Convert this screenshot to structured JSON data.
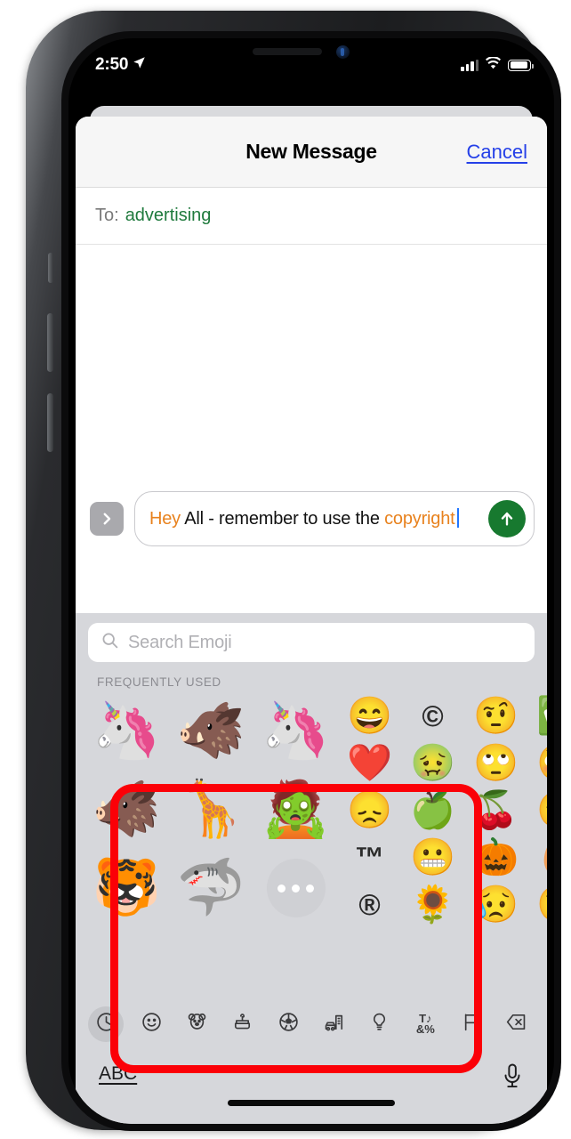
{
  "status_bar": {
    "time": "2:50",
    "location_icon": "location-arrow-icon",
    "signal_icon": "cellular-signal-icon",
    "wifi_icon": "wifi-icon",
    "battery_icon": "battery-icon"
  },
  "sheet": {
    "title": "New Message",
    "cancel_label": "Cancel"
  },
  "to_field": {
    "label": "To:",
    "value": "advertising",
    "value_color": "#1f7a3d"
  },
  "compose": {
    "expand_icon": "chevron-right-icon",
    "message_parts": [
      {
        "text": "Hey",
        "highlight": true
      },
      {
        "text": " All - remember to use the ",
        "highlight": false
      },
      {
        "text": "copyright",
        "highlight": true
      }
    ],
    "message_plain": "Hey All - remember to use the copyright",
    "highlight_color": "#e8821e",
    "send_icon": "send-arrow-up-icon",
    "send_color": "#17792f"
  },
  "emoji_keyboard": {
    "search": {
      "icon": "search-icon",
      "placeholder": "Search Emoji",
      "value": ""
    },
    "section_label": "FREQUENTLY USED",
    "memoji_columns": [
      {
        "name": "memoji-column-1",
        "items": [
          {
            "glyph": "🦄",
            "name": "memoji-unicorn-heart"
          },
          {
            "glyph": "🐗",
            "name": "memoji-boar-sleeping"
          },
          {
            "glyph": "🐯",
            "name": "memoji-tiger-heart-eyes"
          }
        ]
      },
      {
        "name": "memoji-column-2",
        "items": [
          {
            "glyph": "🐗",
            "name": "memoji-boar-laughing-tears"
          },
          {
            "glyph": "🦒",
            "name": "memoji-giraffe-heart"
          },
          {
            "glyph": "🦈",
            "name": "memoji-shark-heart-eyes"
          }
        ]
      },
      {
        "name": "memoji-column-3",
        "items": [
          {
            "glyph": "🦄",
            "name": "memoji-unicorn-mind-blown"
          },
          {
            "glyph": "🧟",
            "name": "memoji-zombie-star-eyes"
          },
          {
            "glyph": "",
            "name": "memoji-more-button"
          }
        ]
      }
    ],
    "emoji_columns": [
      {
        "name": "emoji-column-4",
        "items": [
          {
            "glyph": "😄",
            "name": "emoji-grinning-smiling-eyes",
            "symbol": false
          },
          {
            "glyph": "❤️",
            "name": "emoji-red-heart",
            "symbol": false
          },
          {
            "glyph": "😞",
            "name": "emoji-disappointed-face",
            "symbol": false
          },
          {
            "glyph": "™",
            "name": "emoji-trade-mark",
            "symbol": true
          },
          {
            "glyph": "®",
            "name": "emoji-registered",
            "symbol": true
          }
        ]
      },
      {
        "name": "emoji-column-5",
        "items": [
          {
            "glyph": "©",
            "name": "emoji-copyright",
            "symbol": true
          },
          {
            "glyph": "🤢",
            "name": "emoji-nauseated-face",
            "symbol": false
          },
          {
            "glyph": "🍏",
            "name": "emoji-green-apple",
            "symbol": false
          },
          {
            "glyph": "😬",
            "name": "emoji-grimacing-face",
            "symbol": false
          },
          {
            "glyph": "🌻",
            "name": "emoji-sunflower",
            "symbol": false
          }
        ]
      },
      {
        "name": "emoji-column-6",
        "items": [
          {
            "glyph": "🤨",
            "name": "emoji-raised-eyebrow",
            "symbol": false
          },
          {
            "glyph": "🙄",
            "name": "emoji-rolling-eyes",
            "symbol": false
          },
          {
            "glyph": "🍒",
            "name": "emoji-cherries",
            "symbol": false
          },
          {
            "glyph": "🎃",
            "name": "emoji-jack-o-lantern",
            "symbol": false
          },
          {
            "glyph": "😥",
            "name": "emoji-sad-but-relieved-face",
            "symbol": false
          }
        ]
      },
      {
        "name": "emoji-column-7",
        "items": [
          {
            "glyph": "✅",
            "name": "emoji-check-mark-button",
            "symbol": false
          },
          {
            "glyph": "😳",
            "name": "emoji-flushed-face",
            "symbol": false
          },
          {
            "glyph": "😴",
            "name": "emoji-sleeping-face",
            "symbol": false
          },
          {
            "glyph": "🥚",
            "name": "emoji-egg",
            "symbol": false
          },
          {
            "glyph": "😘",
            "name": "emoji-face-blowing-kiss",
            "symbol": false
          }
        ]
      }
    ],
    "more_button_name": "memoji-more-button",
    "categories": [
      {
        "name": "category-frequently-used",
        "icon": "clock-icon",
        "active": true
      },
      {
        "name": "category-smileys-people",
        "icon": "smiley-icon",
        "active": false
      },
      {
        "name": "category-animals-nature",
        "icon": "bear-icon",
        "active": false
      },
      {
        "name": "category-food-drink",
        "icon": "food-icon",
        "active": false
      },
      {
        "name": "category-activity",
        "icon": "soccer-ball-icon",
        "active": false
      },
      {
        "name": "category-travel-places",
        "icon": "building-car-icon",
        "active": false
      },
      {
        "name": "category-objects",
        "icon": "lightbulb-icon",
        "active": false
      },
      {
        "name": "category-symbols",
        "icon": "symbols-icon",
        "label": "&%",
        "active": false
      },
      {
        "name": "category-flags",
        "icon": "flag-icon",
        "active": false
      },
      {
        "name": "category-delete",
        "icon": "backspace-delete-icon",
        "active": false
      }
    ]
  },
  "bottom_bar": {
    "abc_label": "ABC",
    "mic_icon": "microphone-icon"
  },
  "annotation": {
    "name": "red-highlight-rectangle",
    "color": "#fb0007"
  }
}
